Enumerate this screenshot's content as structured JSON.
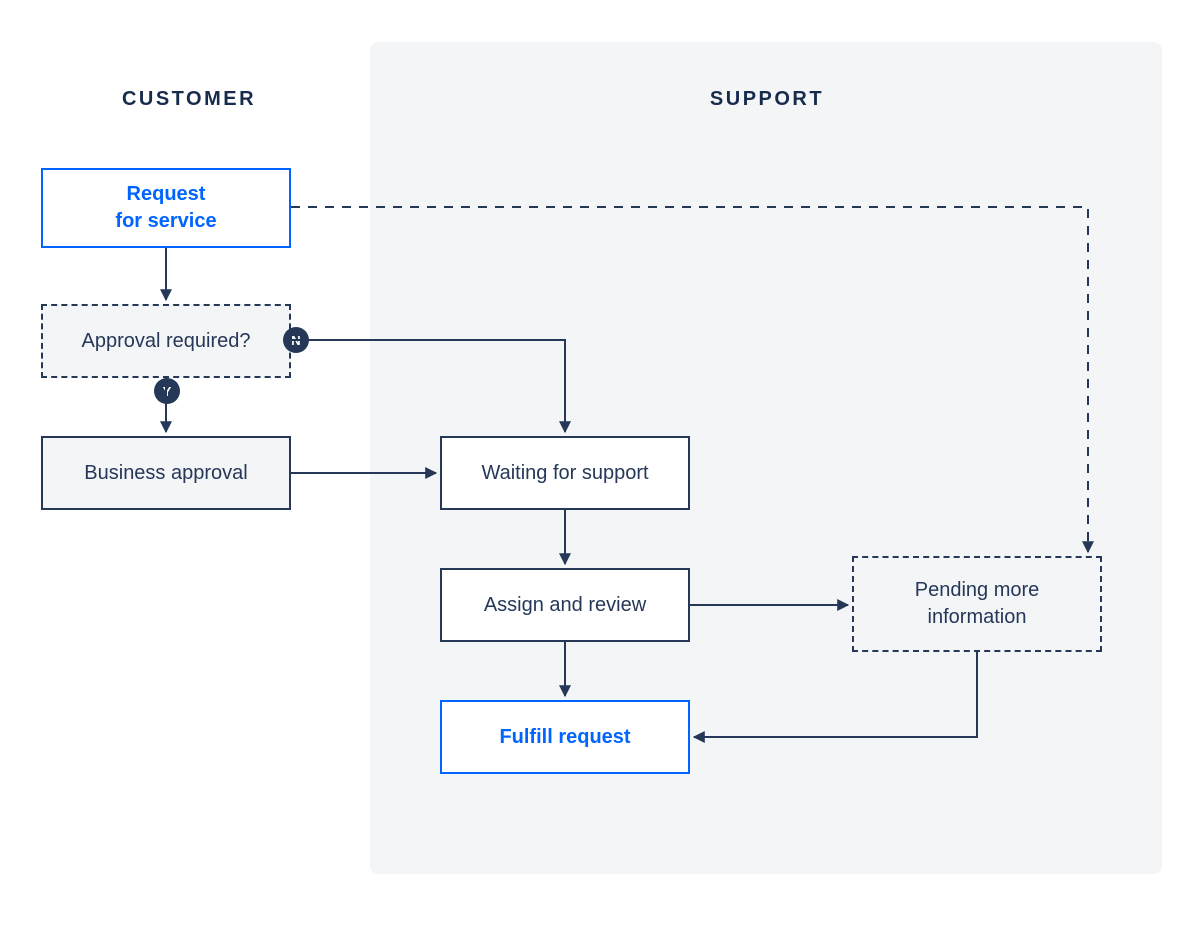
{
  "colors": {
    "accent_blue": "#0065FF",
    "dark_navy": "#253858",
    "text_navy": "#172B4D",
    "panel_grey": "#F4F5F7"
  },
  "lanes": {
    "customer": "CUSTOMER",
    "support": "SUPPORT"
  },
  "nodes": {
    "request_for_service": "Request\nfor service",
    "approval_required": "Approval required?",
    "business_approval": "Business approval",
    "waiting_for_support": "Waiting for support",
    "assign_and_review": "Assign and review",
    "fulfill_request": "Fulfill request",
    "pending_more_information": "Pending more\ninformation"
  },
  "decision_badges": {
    "yes": "Y",
    "no": "N"
  },
  "edges": [
    {
      "from": "request_for_service",
      "to": "approval_required",
      "style": "solid"
    },
    {
      "from": "approval_required",
      "to": "business_approval",
      "label": "Y",
      "style": "solid"
    },
    {
      "from": "approval_required",
      "to": "waiting_for_support",
      "label": "N",
      "style": "solid"
    },
    {
      "from": "business_approval",
      "to": "waiting_for_support",
      "style": "solid"
    },
    {
      "from": "waiting_for_support",
      "to": "assign_and_review",
      "style": "solid"
    },
    {
      "from": "assign_and_review",
      "to": "fulfill_request",
      "style": "solid"
    },
    {
      "from": "assign_and_review",
      "to": "pending_more_information",
      "style": "solid"
    },
    {
      "from": "pending_more_information",
      "to": "fulfill_request",
      "style": "solid"
    },
    {
      "from": "request_for_service",
      "to": "pending_more_information",
      "style": "dashed"
    }
  ]
}
